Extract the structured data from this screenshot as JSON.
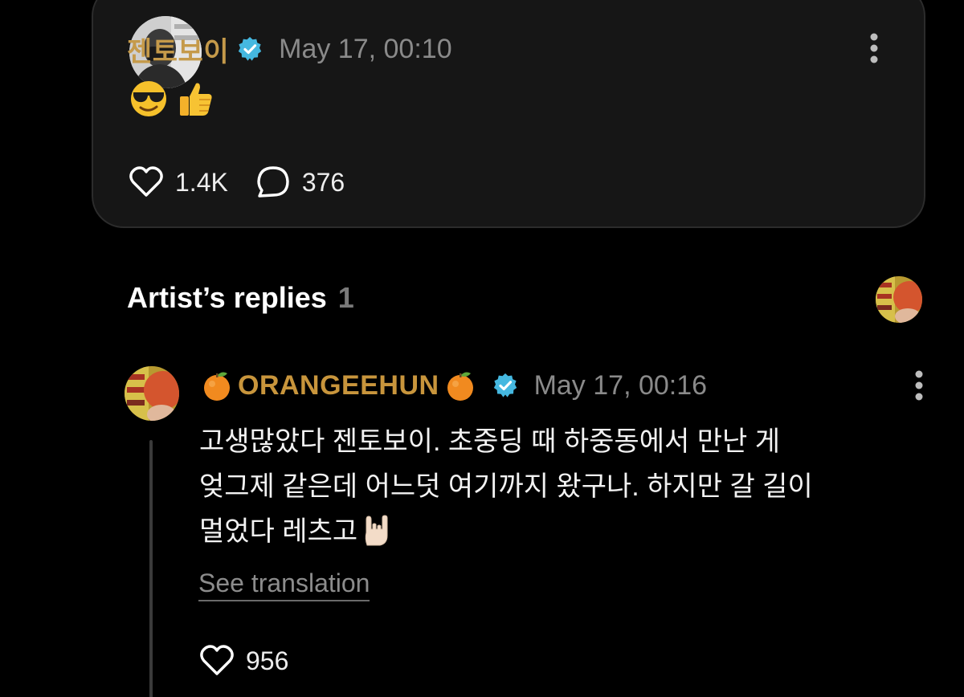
{
  "post": {
    "username": "젠토보이",
    "verified": true,
    "timestamp": "May 17, 00:10",
    "emojis": [
      "smiling-face-with-sunglasses",
      "thumbs-up"
    ],
    "likes": "1.4K",
    "comments": "376"
  },
  "replies": {
    "title": "Artist’s replies",
    "count": "1"
  },
  "reply": {
    "username": "ORANGEEHUN",
    "decoration_emoji": "tangerine",
    "verified": true,
    "timestamp": "May 17, 00:16",
    "body_lines": [
      "고생많았다 젠토보이. 초중딩 때 하중동에서 만난 게",
      "엊그제 같은데 어느덧 여기까지 왔구나. 하지만 갈 길이",
      "멀었다 레츠고"
    ],
    "trailing_emoji": "sign-of-the-horns",
    "see_translation": "See translation",
    "likes": "956"
  },
  "colors": {
    "background": "#000000",
    "card": "#161616",
    "username_gold": "#c59a4a",
    "muted": "#8a8a8a",
    "verified_blue": "#45b8e0"
  }
}
